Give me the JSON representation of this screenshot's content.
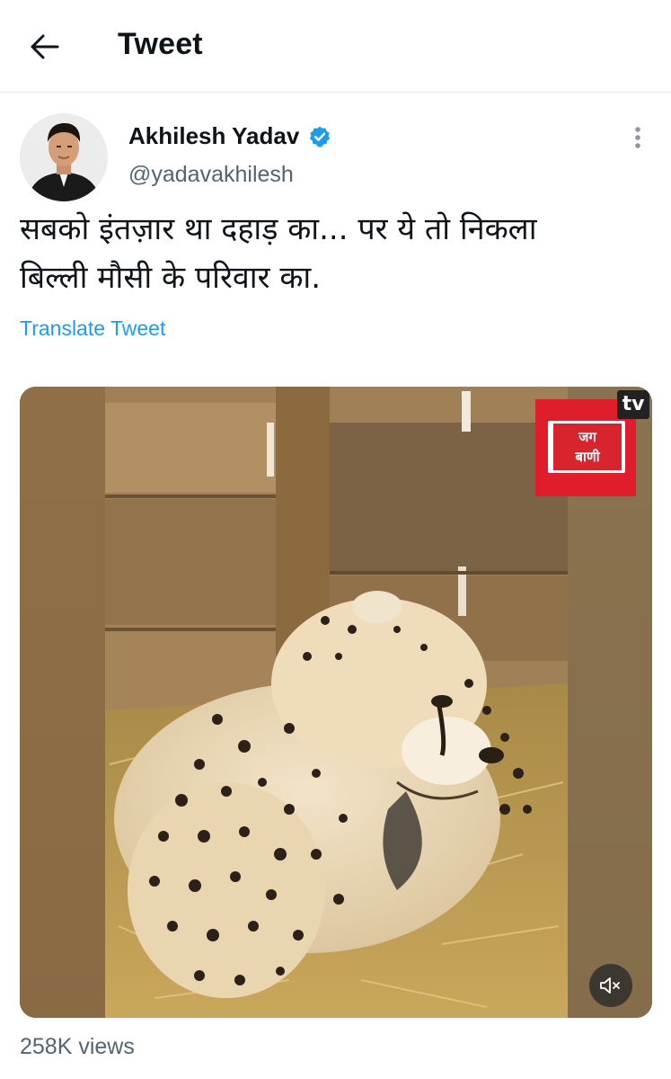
{
  "header": {
    "title": "Tweet",
    "back_icon": "arrow-left-icon"
  },
  "tweet": {
    "author_name": "Akhilesh Yadav",
    "author_handle": "@yadavakhilesh",
    "verified_icon": "verified-badge-icon",
    "more_icon": "more-vertical-icon",
    "text_line1": "सबको इंतज़ार था दहाड़ का... पर ये तो निकला",
    "text_line2": "बिल्ली मौसी के परिवार का.",
    "translate_label": "Translate Tweet",
    "views": "258K views"
  },
  "media": {
    "watermark_line1": "जग",
    "watermark_line2": "बाणी",
    "watermark_tv": "tv",
    "mute_icon": "volume-muted-icon"
  },
  "colors": {
    "accent": "#1d9bf0",
    "secondary_text": "#536471",
    "divider": "#e6ecf0",
    "watermark_red": "#e01e2b"
  }
}
